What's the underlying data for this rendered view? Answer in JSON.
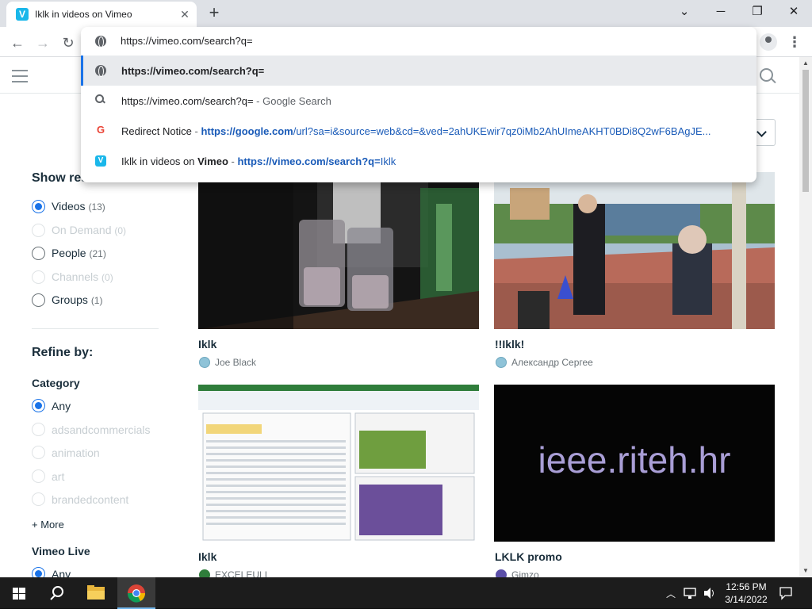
{
  "browser": {
    "tab_title": "Iklk in videos on Vimeo",
    "tab_favicon": "V",
    "close_glyph": "✕",
    "new_tab_glyph": "+",
    "window_min": "─",
    "window_max": "❐",
    "window_close": "✕",
    "collapse_glyph": "⌄",
    "back_glyph": "←",
    "forward_glyph": "→",
    "reload_glyph": "↻",
    "menu_glyph": "⋮"
  },
  "omnibox": {
    "input_value": "https://vimeo.com/search?q=",
    "suggestions": [
      {
        "icon": "globe-icon",
        "url": "https://vimeo.com/search?q="
      },
      {
        "icon": "search-icon",
        "text": "https://vimeo.com/search?q=",
        "sep": " - ",
        "suffix": "Google Search"
      },
      {
        "icon": "google-icon",
        "glyph": "G",
        "title": "Redirect Notice",
        "sep": " - ",
        "url_pre": "https://google.",
        "url_bold": "com",
        "url_rest": "/url?sa=i&source=web&cd=&ved=2ahUKEwir7qz0iMb2AhUImeAKHT0BDi8Q2wF6BAgJE..."
      },
      {
        "icon": "vimeo-icon",
        "glyph": "V",
        "title_pre": "Iklk in videos on ",
        "title_bold": "Vimeo",
        "sep": " - ",
        "url_pre": "https://vimeo.com/search?q=",
        "url_rest": "Iklk"
      }
    ]
  },
  "sidebar": {
    "show_results_heading": "Show results for:",
    "results": [
      {
        "label": "Videos",
        "count": "(13)",
        "checked": true,
        "disabled": false
      },
      {
        "label": "On Demand",
        "count": "(0)",
        "checked": false,
        "disabled": true
      },
      {
        "label": "People",
        "count": "(21)",
        "checked": false,
        "disabled": false
      },
      {
        "label": "Channels",
        "count": "(0)",
        "checked": false,
        "disabled": true
      },
      {
        "label": "Groups",
        "count": "(1)",
        "checked": false,
        "disabled": false
      }
    ],
    "refine_heading": "Refine by:",
    "category_heading": "Category",
    "categories": [
      {
        "label": "Any",
        "checked": true,
        "disabled": false
      },
      {
        "label": "adsandcommercials",
        "checked": false,
        "disabled": true
      },
      {
        "label": "animation",
        "checked": false,
        "disabled": true
      },
      {
        "label": "art",
        "checked": false,
        "disabled": true
      },
      {
        "label": "brandedcontent",
        "checked": false,
        "disabled": true
      }
    ],
    "more_label": "+ More",
    "live_heading": "Vimeo Live",
    "live_any": "Any"
  },
  "videos": [
    {
      "title": "Iklk",
      "author": "Joe Black"
    },
    {
      "title": "!!Iklk!",
      "author": "Александр Сергее"
    },
    {
      "title": "Iklk",
      "author": "EXCELEULI"
    },
    {
      "title": "LKLK promo",
      "author": "Gimzo",
      "thumb_text": "ieee.riteh.hr"
    }
  ],
  "taskbar": {
    "time": "12:56 PM",
    "date": "3/14/2022"
  },
  "colors": {
    "accent": "#1a73e8",
    "vimeo_blue": "#1ab7ea",
    "heading_text": "#1a2e3b",
    "taskbar": "#1c1c1c"
  }
}
